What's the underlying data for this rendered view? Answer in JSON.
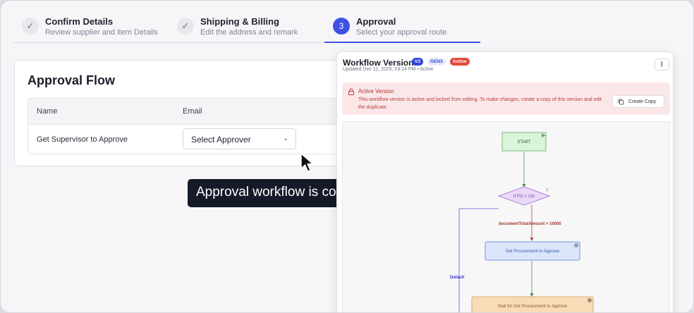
{
  "stepper": {
    "steps": [
      {
        "number": "",
        "title": "Confirm Details",
        "subtitle": "Review supplier and item Details",
        "state": "done"
      },
      {
        "number": "",
        "title": "Shipping & Billing",
        "subtitle": "Edit the address and remark",
        "state": "done"
      },
      {
        "number": "3",
        "title": "Approval",
        "subtitle": "Select your approval route",
        "state": "active"
      }
    ]
  },
  "approval_flow": {
    "title": "Approval Flow",
    "columns": [
      "Name",
      "Email"
    ],
    "rows": [
      {
        "name": "Get Supervisor to Approve",
        "select_value": "Select Approver"
      }
    ]
  },
  "tooltip": {
    "text": "Approval workflow is configurable"
  },
  "workflow": {
    "title": "Workflow Version",
    "badges": {
      "version": "V3",
      "gen": "GEN3",
      "status": "Active"
    },
    "updated": "Updated Dec 11, 2025, 03:14 PM • Active",
    "more_label": "⋮",
    "alert": {
      "title": "Active Version",
      "text": "This workflow version is active and locked from editing. To make changes, create a copy of this version and edit the duplicate.",
      "button": "Create Copy"
    },
    "diagram": {
      "start": "START",
      "condition": "If PO > 10k",
      "condition_marker": "?",
      "edge_label": "documentTotalAmount > 10000",
      "default_label": "Default",
      "node1": "Get Procurement to Approve",
      "node2": "Wait for Get Procurement to Approve"
    }
  },
  "colors": {
    "accent": "#3f51e4",
    "alert_bg": "#fbe7e7",
    "start_fill": "#d9f5d9",
    "decision_fill": "#ead9f7",
    "task_fill": "#dbe6fb",
    "wait_fill": "#f8dcb8"
  }
}
